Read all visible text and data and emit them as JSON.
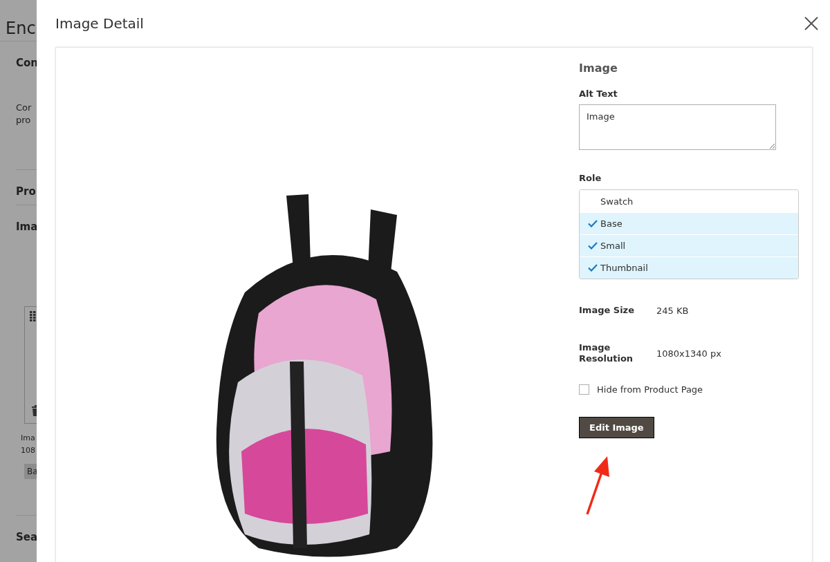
{
  "background_page": {
    "title": "Enc",
    "section_1": "Con",
    "description": [
      "Cor",
      "pro"
    ],
    "section_2": "Pro",
    "section_3": "Ima",
    "tile_caption": [
      "Ima",
      "108"
    ],
    "tile_tag": "Ba",
    "section_4": "Sea"
  },
  "modal": {
    "title": "Image Detail"
  },
  "details": {
    "heading": "Image",
    "alt_text": {
      "label": "Alt Text",
      "value": "Image"
    },
    "role": {
      "label": "Role",
      "options": [
        {
          "label": "Swatch",
          "checked": false
        },
        {
          "label": "Base",
          "checked": true
        },
        {
          "label": "Small",
          "checked": true
        },
        {
          "label": "Thumbnail",
          "checked": true
        }
      ]
    },
    "info": [
      {
        "label": "Image Size",
        "value": "245 KB"
      },
      {
        "label": "Image Resolution",
        "value": "1080x1340 px"
      }
    ],
    "hide_checkbox": {
      "label": "Hide from Product Page",
      "checked": false
    },
    "edit_button": "Edit Image"
  }
}
